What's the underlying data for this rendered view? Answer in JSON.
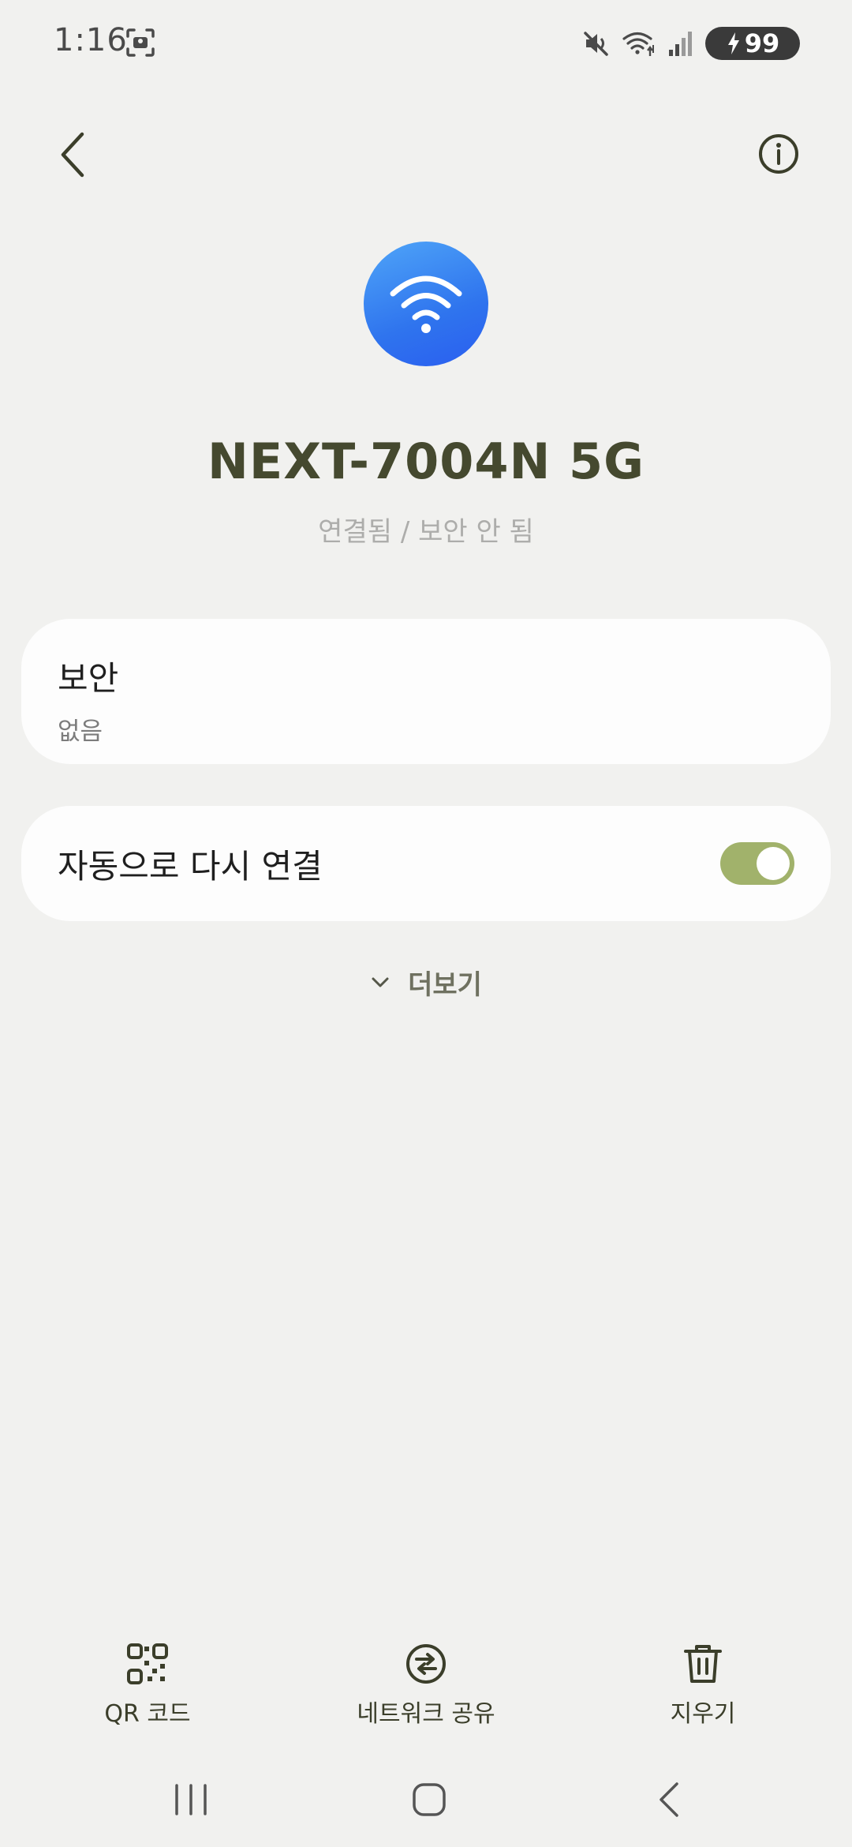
{
  "status_bar": {
    "time": "1:16",
    "battery": "99",
    "icons": [
      "screenshot-icon",
      "mute-icon",
      "wifi-icon",
      "signal-icon",
      "battery-icon"
    ]
  },
  "header": {
    "back_icon": "chevron-left-icon",
    "info_icon": "info-icon"
  },
  "network": {
    "name": "NEXT-7004N 5G",
    "status": "연결됨 / 보안 안 됨",
    "icon": "wifi-icon",
    "icon_gradient": [
      "#4fa5f8",
      "#2a5ef0"
    ]
  },
  "security": {
    "title": "보안",
    "value": "없음"
  },
  "auto_reconnect": {
    "label": "자동으로 다시 연결",
    "enabled": true,
    "toggle_color": "#a1b26b"
  },
  "more": {
    "label": "더보기"
  },
  "actions": [
    {
      "label": "QR 코드",
      "icon": "qr-code-icon"
    },
    {
      "label": "네트워크 공유",
      "icon": "share-network-icon"
    },
    {
      "label": "지우기",
      "icon": "trash-icon"
    }
  ],
  "nav": {
    "items": [
      "recent-apps-icon",
      "home-icon",
      "back-icon"
    ]
  }
}
